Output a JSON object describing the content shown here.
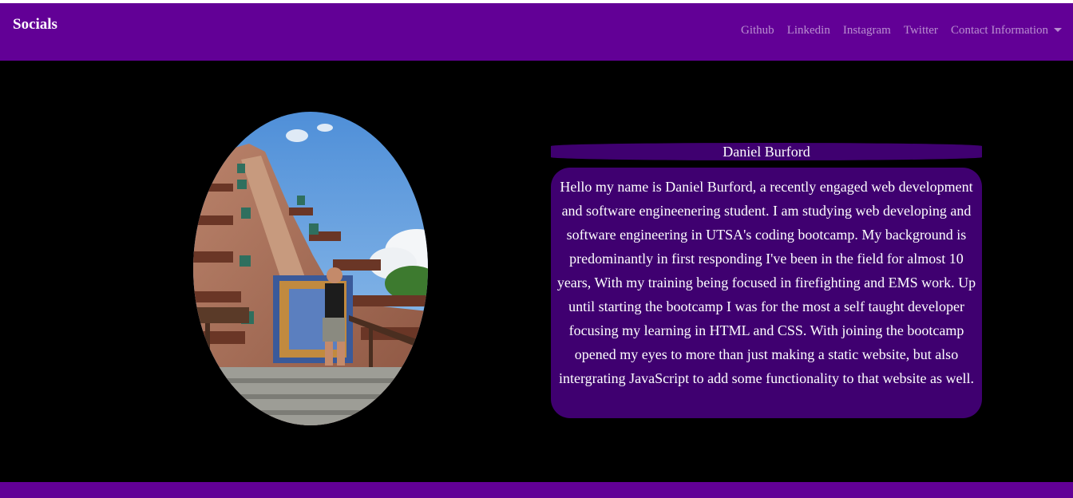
{
  "nav": {
    "brand": "Socials",
    "links": [
      "Github",
      "Linkedin",
      "Instagram",
      "Twitter"
    ],
    "dropdown_label": "Contact Information"
  },
  "profile": {
    "name": "Daniel Burford",
    "bio": "Hello my name is Daniel Burford, a recently engaged web development and software engineenering student. I am studying web developing and software engineering in UTSA's coding bootcamp. My background is predominantly in first responding I've been in the field for almost 10 years, With my training being focused in firefighting and EMS work. Up until starting the bootcamp I was for the most a self taught developer focusing my learning in HTML and CSS. With joining the bootcamp opened my eyes to more than just making a static website, but also intergrating JavaScript to add some functionality to that website as well."
  },
  "colors": {
    "navbar": "#620096",
    "card": "#3f0070",
    "background": "#000000"
  }
}
